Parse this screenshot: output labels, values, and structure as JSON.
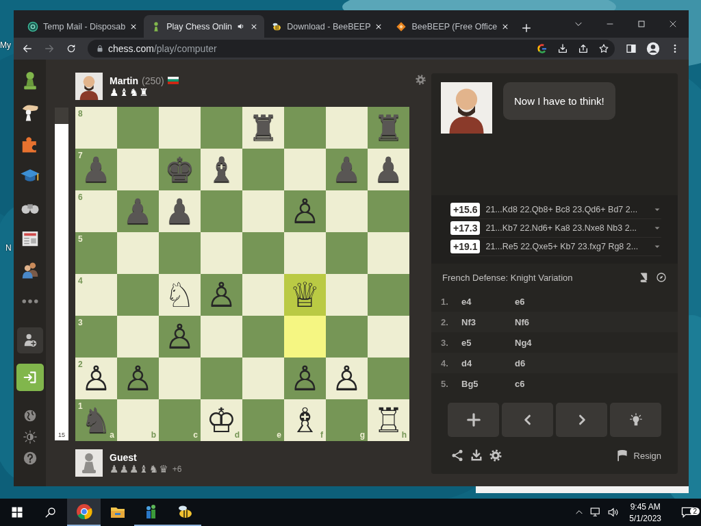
{
  "desktop": {
    "labels": [
      "My",
      "N"
    ]
  },
  "browser": {
    "tabs": [
      {
        "kind": "mail",
        "title": "Temp Mail - Disposab",
        "selected": false,
        "audio": false
      },
      {
        "kind": "chess",
        "title": "Play Chess Onlin",
        "selected": true,
        "audio": true
      },
      {
        "kind": "bee",
        "title": "Download - BeeBEEP",
        "selected": false,
        "audio": false
      },
      {
        "kind": "diamond",
        "title": "BeeBEEP (Free Office",
        "selected": false,
        "audio": false
      }
    ],
    "forward_disabled": true,
    "url": {
      "host": "chess.com",
      "path": "/play/computer"
    }
  },
  "game": {
    "top_player": {
      "name": "Martin",
      "rating": "(250)",
      "captured": "♟♝♞♜",
      "captured_black": false
    },
    "bottom_player": {
      "name": "Guest",
      "captured": "♟♟♟♝♞♛",
      "captured_black": true,
      "advantage": "+6"
    },
    "eval": {
      "level": 0.95,
      "reading": "15"
    },
    "board": {
      "files": [
        "a",
        "b",
        "c",
        "d",
        "e",
        "f",
        "g",
        "h"
      ],
      "ranks": [
        {
          "label": "8",
          "squares": [
            {
              "highlighted": false
            },
            {
              "highlighted": false
            },
            {
              "highlighted": false
            },
            {
              "highlighted": false
            },
            {
              "highlighted": false,
              "piece": "♜",
              "black": true
            },
            {
              "highlighted": false
            },
            {
              "highlighted": false
            },
            {
              "highlighted": false,
              "piece": "♜",
              "black": true
            }
          ]
        },
        {
          "label": "7",
          "squares": [
            {
              "highlighted": false,
              "piece": "♟",
              "black": true
            },
            {
              "highlighted": false
            },
            {
              "highlighted": false,
              "piece": "♚",
              "black": true
            },
            {
              "highlighted": false,
              "piece": "♝",
              "black": true
            },
            {
              "highlighted": false
            },
            {
              "highlighted": false
            },
            {
              "highlighted": false,
              "piece": "♟",
              "black": true
            },
            {
              "highlighted": false,
              "piece": "♟",
              "black": true
            }
          ]
        },
        {
          "label": "6",
          "squares": [
            {
              "highlighted": false
            },
            {
              "highlighted": false,
              "piece": "♟",
              "black": true
            },
            {
              "highlighted": false,
              "piece": "♟",
              "black": true
            },
            {
              "highlighted": false
            },
            {
              "highlighted": false
            },
            {
              "highlighted": false,
              "piece": "♙",
              "black": false
            },
            {
              "highlighted": false
            },
            {
              "highlighted": false
            }
          ]
        },
        {
          "label": "5",
          "squares": [
            {
              "highlighted": false
            },
            {
              "highlighted": false
            },
            {
              "highlighted": false
            },
            {
              "highlighted": false
            },
            {
              "highlighted": false
            },
            {
              "highlighted": false
            },
            {
              "highlighted": false
            },
            {
              "highlighted": false
            }
          ]
        },
        {
          "label": "4",
          "squares": [
            {
              "highlighted": false
            },
            {
              "highlighted": false
            },
            {
              "highlighted": false,
              "piece": "♘",
              "black": false
            },
            {
              "highlighted": false,
              "piece": "♙",
              "black": false
            },
            {
              "highlighted": false
            },
            {
              "highlighted": true,
              "piece": "♕",
              "black": false
            },
            {
              "highlighted": false
            },
            {
              "highlighted": false
            }
          ]
        },
        {
          "label": "3",
          "squares": [
            {
              "highlighted": false
            },
            {
              "highlighted": false
            },
            {
              "highlighted": false,
              "piece": "♙",
              "black": false
            },
            {
              "highlighted": false
            },
            {
              "highlighted": false
            },
            {
              "highlighted": true
            },
            {
              "highlighted": false
            },
            {
              "highlighted": false
            }
          ]
        },
        {
          "label": "2",
          "squares": [
            {
              "highlighted": false,
              "piece": "♙",
              "black": false
            },
            {
              "highlighted": false,
              "piece": "♙",
              "black": false
            },
            {
              "highlighted": false
            },
            {
              "highlighted": false
            },
            {
              "highlighted": false
            },
            {
              "highlighted": false,
              "piece": "♙",
              "black": false
            },
            {
              "highlighted": false,
              "piece": "♙",
              "black": false
            },
            {
              "highlighted": false
            }
          ]
        },
        {
          "label": "1",
          "squares": [
            {
              "highlighted": false,
              "piece": "♞",
              "black": true
            },
            {
              "highlighted": false
            },
            {
              "highlighted": false
            },
            {
              "highlighted": false,
              "piece": "♔",
              "black": false
            },
            {
              "highlighted": false
            },
            {
              "highlighted": false,
              "piece": "♗",
              "black": false
            },
            {
              "highlighted": false
            },
            {
              "highlighted": false,
              "piece": "♖",
              "black": false
            }
          ]
        }
      ]
    }
  },
  "coach": {
    "message": "Now I have to think!"
  },
  "engine_lines": [
    {
      "score": "+15.6",
      "line": "21...Kd8 22.Qb8+ Bc8 23.Qd6+ Bd7 2..."
    },
    {
      "score": "+17.3",
      "line": "21...Kb7 22.Nd6+ Ka8 23.Nxe8 Nb3 2..."
    },
    {
      "score": "+19.1",
      "line": "21...Re5 22.Qxe5+ Kb7 23.fxg7 Rg8 2..."
    }
  ],
  "opening": "French Defense: Knight Variation",
  "moves": [
    {
      "number": "1.",
      "white": "e4",
      "black": "e6"
    },
    {
      "number": "2.",
      "white": "Nf3",
      "black": "Nf6"
    },
    {
      "number": "3.",
      "white": "e5",
      "black": "Ng4"
    },
    {
      "number": "4.",
      "white": "d4",
      "black": "d6"
    },
    {
      "number": "5.",
      "white": "Bg5",
      "black": "c6"
    }
  ],
  "resign": "Resign",
  "taskbar": {
    "apps": [
      {
        "kind": "browser",
        "running": true,
        "active": true
      },
      {
        "kind": "folder",
        "running": false,
        "active": false
      },
      {
        "kind": "people",
        "running": true,
        "active": false
      },
      {
        "kind": "bee",
        "running": true,
        "active": false
      }
    ],
    "time": "9:45 AM",
    "date": "5/1/2023",
    "notifications": "2"
  }
}
